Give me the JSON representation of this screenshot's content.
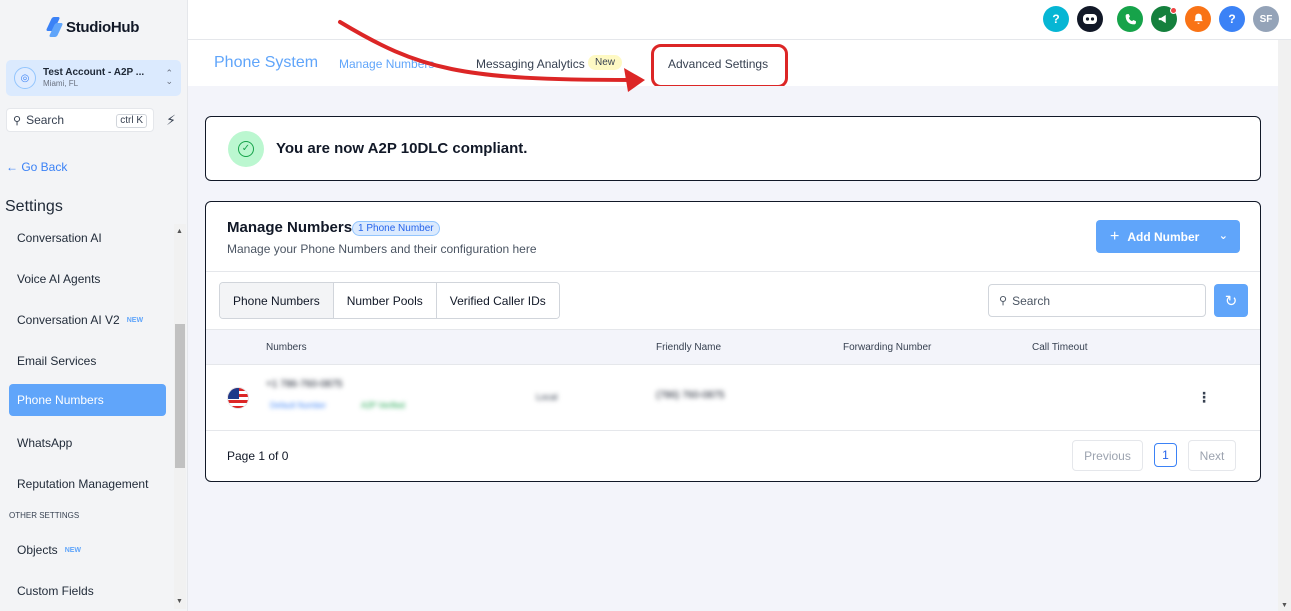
{
  "brand": {
    "name": "StudioHub"
  },
  "account": {
    "name": "Test Account - A2P ...",
    "location": "Miami, FL"
  },
  "sidebar": {
    "search_placeholder": "Search",
    "search_shortcut": "ctrl K",
    "go_back": "← Go Back",
    "settings_heading": "Settings",
    "items": [
      {
        "label": "Conversation AI",
        "tag": ""
      },
      {
        "label": "Voice AI Agents",
        "tag": ""
      },
      {
        "label": "Conversation AI V2",
        "tag": "NEW"
      },
      {
        "label": "Email Services",
        "tag": ""
      },
      {
        "label": "Phone Numbers",
        "tag": ""
      },
      {
        "label": "WhatsApp",
        "tag": ""
      },
      {
        "label": "Reputation Management",
        "tag": ""
      }
    ],
    "other_section": "OTHER SETTINGS",
    "other_items": [
      {
        "label": "Objects",
        "tag": "NEW"
      },
      {
        "label": "Custom Fields",
        "tag": ""
      }
    ]
  },
  "topbar": {
    "icons": [
      {
        "name": "help-icon",
        "glyph": "?",
        "color": "#06b6d4"
      },
      {
        "name": "assistant-icon",
        "glyph": "◉",
        "color": "#111827"
      },
      {
        "name": "phone-icon",
        "glyph": "✆",
        "color": "#16a34a"
      },
      {
        "name": "megaphone-icon",
        "glyph": "📣",
        "color": "#15803d"
      },
      {
        "name": "bell-icon",
        "glyph": "🔔",
        "color": "#f97316"
      },
      {
        "name": "help-icon",
        "glyph": "?",
        "color": "#3b82f6"
      },
      {
        "name": "user-avatar",
        "glyph": "SF",
        "color": "#94a3b8"
      }
    ]
  },
  "tabs": {
    "title": "Phone System",
    "manage": "Manage Numbers",
    "messaging": "Messaging Analytics",
    "messaging_badge": "New",
    "advanced": "Advanced Settings"
  },
  "compliance": {
    "message": "You are now A2P 10DLC compliant."
  },
  "manage": {
    "title": "Manage Numbers",
    "count": "1 Phone Number",
    "subtitle": "Manage your Phone Numbers and their configuration here",
    "add_button": "Add Number",
    "segments": [
      "Phone Numbers",
      "Number Pools",
      "Verified Caller IDs"
    ],
    "search_placeholder": "Search",
    "columns": [
      "Numbers",
      "Friendly Name",
      "Forwarding Number",
      "Call Timeout"
    ],
    "row": {
      "number": "+1 786-760-0875",
      "type": "Default Number",
      "status": "A2P Verified",
      "kind": "Local",
      "friendly": "(786) 760-0875"
    },
    "page_text": "Page 1 of 0",
    "prev": "Previous",
    "page": "1",
    "next": "Next"
  },
  "colors": {
    "accent": "#60a5fa",
    "highlight": "#dc2626",
    "success": "#16a34a"
  }
}
